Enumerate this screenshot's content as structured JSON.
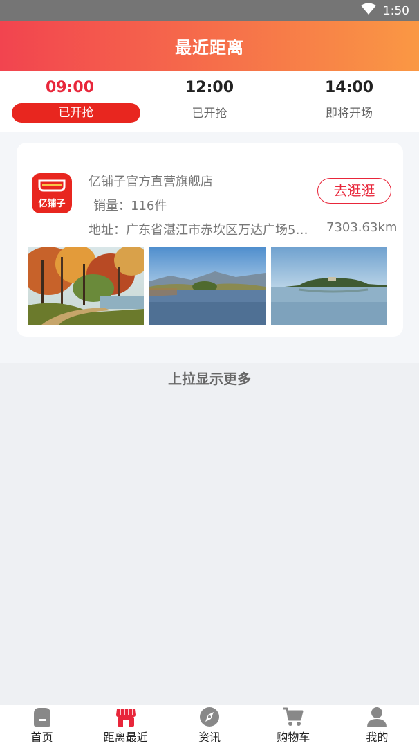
{
  "status_bar": {
    "time": "1:50"
  },
  "header": {
    "title": "最近距离"
  },
  "tabs": [
    {
      "time": "09:00",
      "state": "已开抢",
      "active": true
    },
    {
      "time": "12:00",
      "state": "已开抢",
      "active": false
    },
    {
      "time": "14:00",
      "state": "即将开场",
      "active": false
    }
  ],
  "shop": {
    "logo_text": "亿铺子",
    "name": "亿铺子官方直营旗舰店",
    "sales": "销量：116件",
    "address": "地址：广东省湛江市赤坎区万达广场5栋...",
    "distance": "7303.63km",
    "visit_label": "去逛逛",
    "photos": [
      "autumn-forest-photo",
      "lake-mountain-photo",
      "lake-island-photo"
    ]
  },
  "footer": {
    "more_text": "上拉显示更多"
  },
  "bottom_nav": [
    {
      "label": "首页",
      "icon": "home-icon",
      "active": false
    },
    {
      "label": "距离最近",
      "icon": "shop-icon",
      "active": true
    },
    {
      "label": "资讯",
      "icon": "compass-icon",
      "active": false
    },
    {
      "label": "购物车",
      "icon": "cart-icon",
      "active": false
    },
    {
      "label": "我的",
      "icon": "user-icon",
      "active": false
    }
  ],
  "colors": {
    "accent": "#e8263a",
    "header_start": "#f2444f",
    "header_end": "#fa9844",
    "active_pill": "#e8261f",
    "nav_inactive": "#888888"
  }
}
